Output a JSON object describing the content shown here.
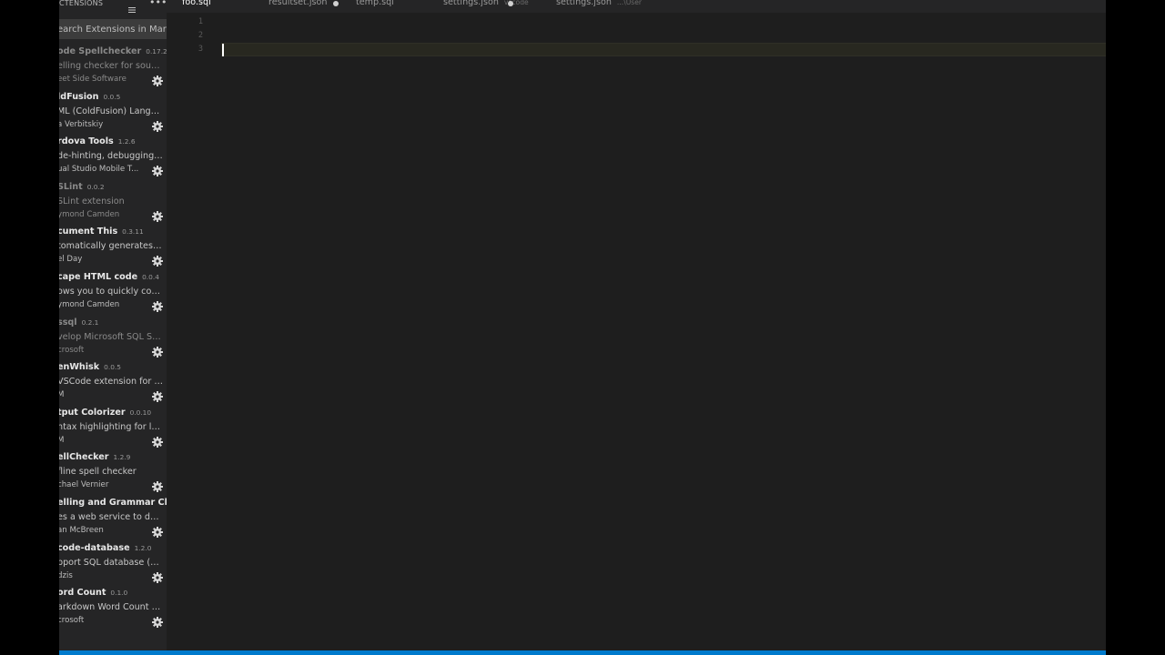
{
  "sidebar": {
    "title": "CTENSIONS",
    "search_placeholder": "earch Extensions in Marke",
    "extensions": [
      {
        "name": "ode Spellchecker",
        "version": "0.17.2",
        "description": "elling checker for sourc...",
        "publisher": "eet Side Software",
        "disabled": true
      },
      {
        "name": "ldFusion",
        "version": "0.0.5",
        "description": "ML (ColdFusion) Langu...",
        "publisher": "a Verbitskiy",
        "disabled": false
      },
      {
        "name": "rdova Tools",
        "version": "1.2.6",
        "description": "de-hinting, debugging ...",
        "publisher": "ual Studio Mobile T...",
        "disabled": false
      },
      {
        "name": "SLint",
        "version": "0.0.2",
        "description": "SLint extension",
        "publisher": "ymond Camden",
        "disabled": true
      },
      {
        "name": "cument This",
        "version": "0.3.11",
        "description": "tomatically generates d...",
        "publisher": "el Day",
        "disabled": false
      },
      {
        "name": "cape HTML code",
        "version": "0.0.4",
        "description": "ows you to quickly con...",
        "publisher": "ymond Camden",
        "disabled": false
      },
      {
        "name": "ssql",
        "version": "0.2.1",
        "description": "velop Microsoft SQL Se...",
        "publisher": "crosoft",
        "disabled": true
      },
      {
        "name": "enWhisk",
        "version": "0.0.5",
        "description": "VSCode extension for O...",
        "publisher": "M",
        "disabled": false
      },
      {
        "name": "tput Colorizer",
        "version": "0.0.10",
        "description": "ntax highlighting for lo...",
        "publisher": "M",
        "disabled": false
      },
      {
        "name": "ellChecker",
        "version": "1.2.9",
        "description": "fline spell checker",
        "publisher": "chael Vernier",
        "disabled": false
      },
      {
        "name": "elling and Grammar Che",
        "version": "",
        "description": "es a web service to det...",
        "publisher": "an McBreen",
        "disabled": false
      },
      {
        "name": "code-database",
        "version": "1.2.0",
        "description": "pport SQL database (m...",
        "publisher": "dzis",
        "disabled": false
      },
      {
        "name": "ord Count",
        "version": "0.1.0",
        "description": "arkdown Word Count E...",
        "publisher": "crosoft",
        "disabled": false
      }
    ]
  },
  "tabs": [
    {
      "label": "foo.sql",
      "path": "",
      "active": true,
      "dirty": false
    },
    {
      "label": "resultset.json",
      "path": "",
      "active": false,
      "dirty": true
    },
    {
      "label": "temp.sql",
      "path": "",
      "active": false,
      "dirty": false
    },
    {
      "label": "settings.json",
      "path": "vscode",
      "active": false,
      "dirty": true
    },
    {
      "label": "settings.json",
      "path": "...\\User",
      "active": false,
      "dirty": false
    }
  ],
  "editor": {
    "line_numbers": [
      "1",
      "2",
      "3"
    ]
  },
  "colors": {
    "status_bar": "#007acc",
    "editor_bg": "#1e1e1e",
    "sidebar_bg": "#252526"
  },
  "icons": {
    "clear": "clear-all-icon",
    "more": "more-actions-icon",
    "manage": "gear-icon"
  }
}
